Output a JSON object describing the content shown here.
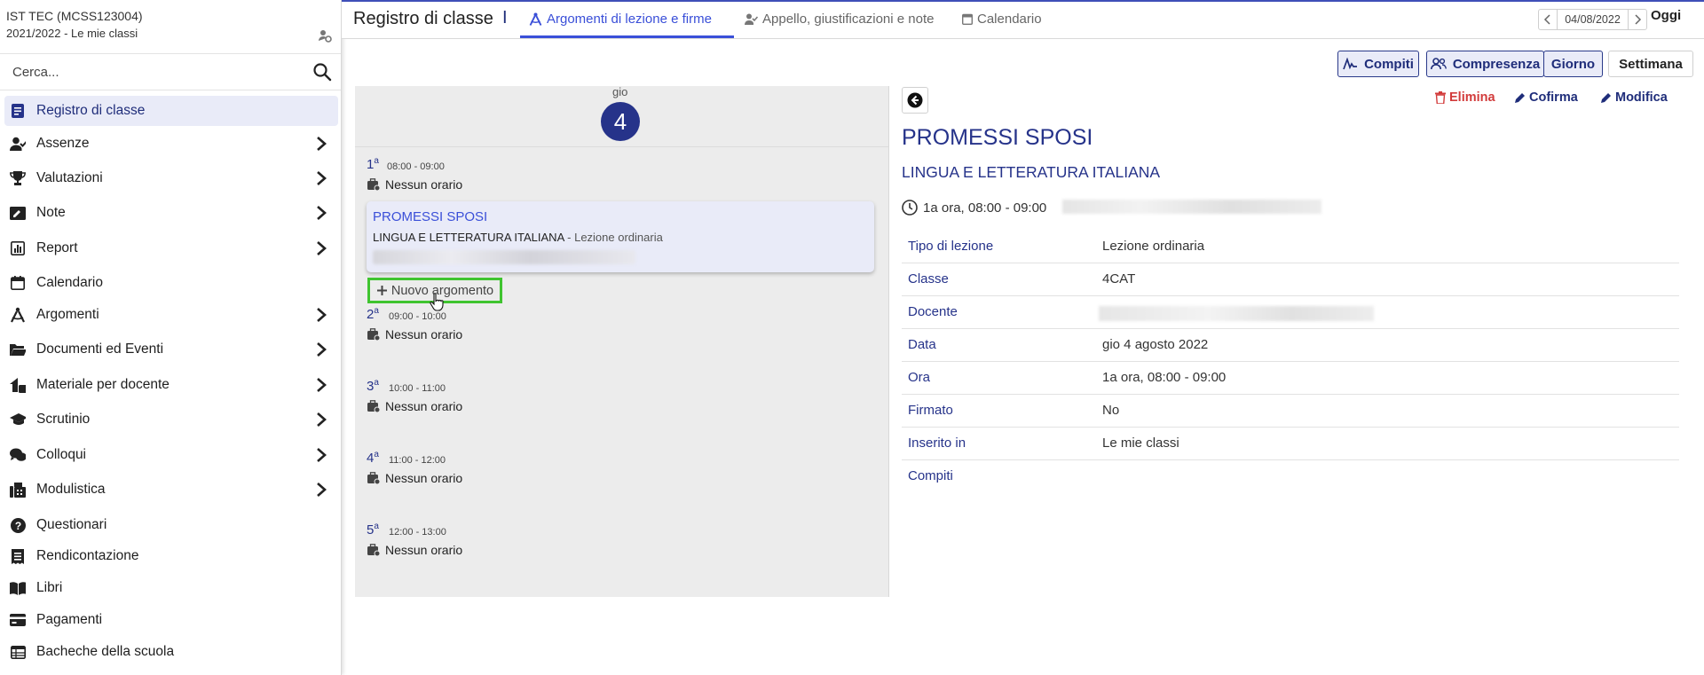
{
  "sidebar": {
    "school": "IST TEC (MCSS123004)",
    "year": "2021/2022 - Le mie classi",
    "search_placeholder": "Cerca...",
    "items": [
      {
        "label": "Registro di classe",
        "icon": "register-icon"
      },
      {
        "label": "Assenze",
        "icon": "user-check-icon"
      },
      {
        "label": "Valutazioni",
        "icon": "trophy-icon"
      },
      {
        "label": "Note",
        "icon": "note-icon"
      },
      {
        "label": "Report",
        "icon": "report-icon"
      },
      {
        "label": "Calendario",
        "icon": "calendar-icon"
      },
      {
        "label": "Argomenti",
        "icon": "compass-icon"
      },
      {
        "label": "Documenti ed Eventi",
        "icon": "folder-icon"
      },
      {
        "label": "Materiale per docente",
        "icon": "material-icon"
      },
      {
        "label": "Scrutinio",
        "icon": "graduation-cap-icon"
      },
      {
        "label": "Colloqui",
        "icon": "chat-icon"
      },
      {
        "label": "Modulistica",
        "icon": "fax-icon"
      },
      {
        "label": "Questionari",
        "icon": "question-icon"
      },
      {
        "label": "Rendicontazione",
        "icon": "receipt-icon"
      },
      {
        "label": "Libri",
        "icon": "book-icon"
      },
      {
        "label": "Pagamenti",
        "icon": "credit-card-icon"
      },
      {
        "label": "Bacheche della scuola",
        "icon": "board-icon"
      }
    ]
  },
  "header": {
    "title": "Registro di classe",
    "separator": "I",
    "tabs": [
      {
        "label": "Argomenti di lezione e firme"
      },
      {
        "label": "Appello, giustificazioni e note"
      },
      {
        "label": "Calendario"
      }
    ],
    "date": "04/08/2022",
    "today": "Oggi"
  },
  "toolbar": {
    "compiti": "Compiti",
    "compresenza": "Compresenza",
    "giorno": "Giorno",
    "settimana": "Settimana"
  },
  "day": {
    "name": "gio",
    "number": "4",
    "slots": [
      {
        "n": "1",
        "sup": "a",
        "range": "08:00 - 09:00",
        "status": "Nessun orario"
      },
      {
        "n": "2",
        "sup": "a",
        "range": "09:00 - 10:00",
        "status": "Nessun orario"
      },
      {
        "n": "3",
        "sup": "a",
        "range": "10:00 - 11:00",
        "status": "Nessun orario"
      },
      {
        "n": "4",
        "sup": "a",
        "range": "11:00 - 12:00",
        "status": "Nessun orario"
      },
      {
        "n": "5",
        "sup": "a",
        "range": "12:00 - 13:00",
        "status": "Nessun orario"
      }
    ],
    "card": {
      "title": "PROMESSI SPOSI",
      "subject": "LINGUA E LETTERATURA ITALIANA",
      "type": " - Lezione ordinaria"
    },
    "new_topic": "Nuovo argomento"
  },
  "detail": {
    "actions": {
      "elimina": "Elimina",
      "cofirma": "Cofirma",
      "modifica": "Modifica"
    },
    "title": "PROMESSI SPOSI",
    "subject": "LINGUA E LETTERATURA ITALIANA",
    "time": "1a ora, 08:00 - 09:00",
    "rows": [
      {
        "k": "Tipo di lezione",
        "v": "Lezione ordinaria"
      },
      {
        "k": "Classe",
        "v": "4CAT"
      },
      {
        "k": "Docente",
        "v": ""
      },
      {
        "k": "Data",
        "v": "gio 4 agosto 2022"
      },
      {
        "k": "Ora",
        "v": "1a ora, 08:00 - 09:00"
      },
      {
        "k": "Firmato",
        "v": "No"
      },
      {
        "k": "Inserito in",
        "v": "Le mie classi"
      },
      {
        "k": "Compiti",
        "v": ""
      }
    ]
  },
  "colors": {
    "accent": "#26338a",
    "tab_active": "#3a4fd8",
    "danger": "#d23b3b",
    "highlight": "#3fc42f"
  }
}
